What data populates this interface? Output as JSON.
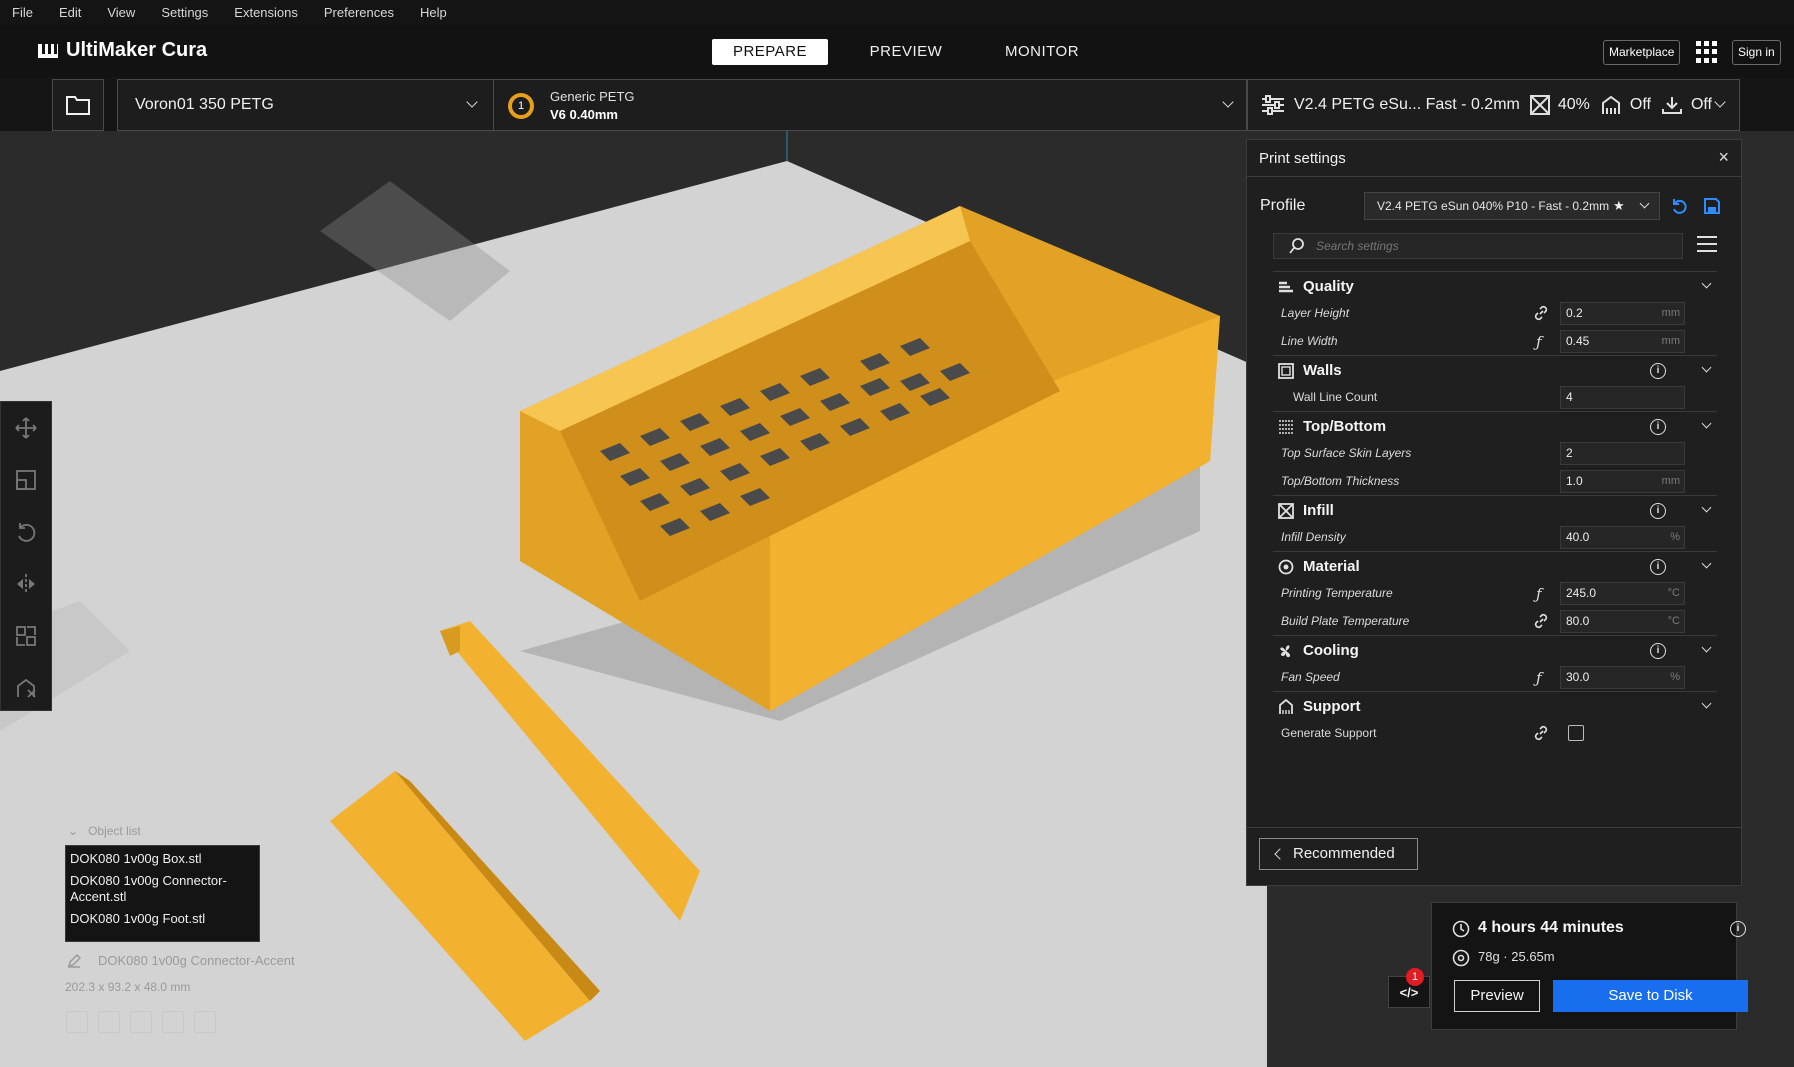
{
  "menubar": {
    "items": [
      "File",
      "Edit",
      "View",
      "Settings",
      "Extensions",
      "Preferences",
      "Help"
    ]
  },
  "header": {
    "app_name": "UltiMaker Cura",
    "stages": [
      "PREPARE",
      "PREVIEW",
      "MONITOR"
    ],
    "active_stage": "PREPARE",
    "marketplace": "Marketplace",
    "sign_in": "Sign in"
  },
  "toolbar": {
    "machine": "Voron01 350 PETG",
    "extruder_number": "1",
    "material": "Generic PETG",
    "nozzle": "V6 0.40mm",
    "print_profile": "V2.4 PETG eSu... Fast - 0.2mm",
    "infill": "40%",
    "support": "Off",
    "adhesion": "Off"
  },
  "objects": {
    "header": "Object list",
    "items": [
      "DOK080 1v00g Box.stl",
      "DOK080 1v00g Connector-Accent.stl",
      "DOK080 1v00g Foot.stl"
    ],
    "selected": "DOK080 1v00g Connector-Accent",
    "dimensions": "202.3 x 93.2 x 48.0 mm"
  },
  "print_settings": {
    "title": "Print settings",
    "profile_label": "Profile",
    "profile_value": "V2.4 PETG eSun 040% P10 - Fast - 0.2mm",
    "search_placeholder": "Search settings",
    "recommended": "Recommended",
    "sections": {
      "quality": {
        "label": "Quality",
        "layer_height": {
          "label": "Layer Height",
          "value": "0.2",
          "unit": "mm"
        },
        "line_width": {
          "label": "Line Width",
          "value": "0.45",
          "unit": "mm"
        }
      },
      "walls": {
        "label": "Walls",
        "wall_line_count": {
          "label": "Wall Line Count",
          "value": "4"
        }
      },
      "topbottom": {
        "label": "Top/Bottom",
        "top_skin_layers": {
          "label": "Top Surface Skin Layers",
          "value": "2"
        },
        "thickness": {
          "label": "Top/Bottom Thickness",
          "value": "1.0",
          "unit": "mm"
        }
      },
      "infill": {
        "label": "Infill",
        "density": {
          "label": "Infill Density",
          "value": "40.0",
          "unit": "%"
        }
      },
      "material": {
        "label": "Material",
        "print_temp": {
          "label": "Printing Temperature",
          "value": "245.0",
          "unit": "°C"
        },
        "bed_temp": {
          "label": "Build Plate Temperature",
          "value": "80.0",
          "unit": "°C"
        }
      },
      "cooling": {
        "label": "Cooling",
        "fan_speed": {
          "label": "Fan Speed",
          "value": "30.0",
          "unit": "%"
        }
      },
      "support": {
        "label": "Support",
        "generate": {
          "label": "Generate Support",
          "checked": false
        }
      }
    }
  },
  "action_panel": {
    "time": "4 hours 44 minutes",
    "material_usage": "78g · 25.65m",
    "preview": "Preview",
    "save": "Save to Disk",
    "notification_count": "1",
    "code_label": "</>"
  },
  "colors": {
    "accent": "#196ef0",
    "model": "#f2b22f",
    "badge": "#e31b23"
  }
}
